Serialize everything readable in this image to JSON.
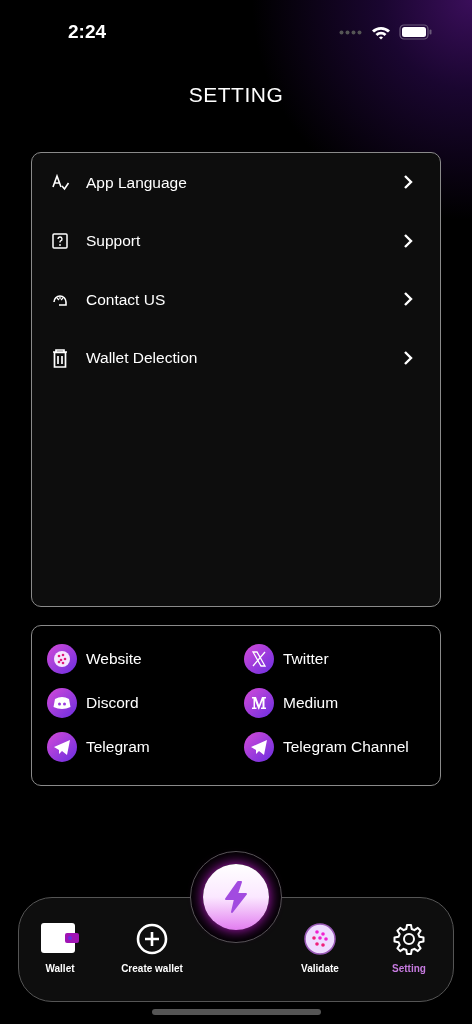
{
  "status_bar": {
    "time": "2:24"
  },
  "title": "SETTING",
  "settings": [
    {
      "kind": "language",
      "label": "App Language"
    },
    {
      "kind": "support",
      "label": "Support"
    },
    {
      "kind": "contact",
      "label": "Contact US"
    },
    {
      "kind": "trash",
      "label": "Wallet Delection"
    }
  ],
  "links": [
    {
      "kind": "website",
      "label": "Website"
    },
    {
      "kind": "x",
      "label": "Twitter"
    },
    {
      "kind": "discord",
      "label": "Discord"
    },
    {
      "kind": "medium",
      "label": "Medium"
    },
    {
      "kind": "telegram",
      "label": "Telegram"
    },
    {
      "kind": "telegram",
      "label": "Telegram Channel"
    }
  ],
  "tab_bar": [
    {
      "kind": "wallet",
      "label": "Wallet",
      "selected": false
    },
    {
      "kind": "plus",
      "label": "Create wallet",
      "selected": false
    },
    {
      "kind": "validate",
      "label": "Validate",
      "selected": false
    },
    {
      "kind": "gear",
      "label": "Setting",
      "selected": true
    }
  ]
}
